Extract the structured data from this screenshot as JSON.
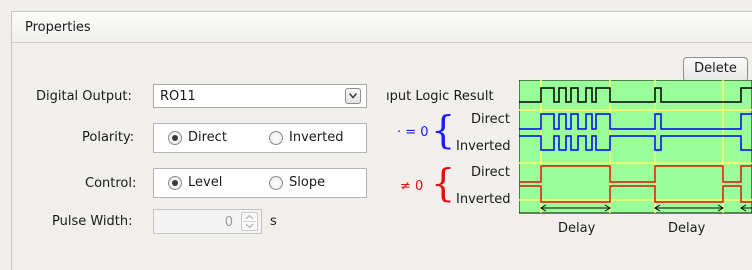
{
  "panel": {
    "title": "Properties"
  },
  "digital_output": {
    "label": "Digital Output:",
    "value": "RO11"
  },
  "polarity": {
    "label": "Polarity:",
    "options": [
      "Direct",
      "Inverted"
    ],
    "selected": "Direct"
  },
  "control": {
    "label": "Control:",
    "options": [
      "Level",
      "Slope"
    ],
    "selected": "Level"
  },
  "pulse_width": {
    "label": "Pulse Width:",
    "value": "0",
    "unit": "s"
  },
  "delete_label": "Delete",
  "diagram": {
    "input_logic_label": "ıput Logic Result",
    "direct_label": "Direct",
    "inverted_label": "Inverted",
    "eq_zero": "· = 0",
    "neq_zero": "≠ 0",
    "delay_label": "Delay",
    "colors": {
      "background": "#99ff99",
      "input": "#000000",
      "level_signal": "#0000ff",
      "slope_signal": "#e01010",
      "guide": "#ffff66"
    }
  }
}
